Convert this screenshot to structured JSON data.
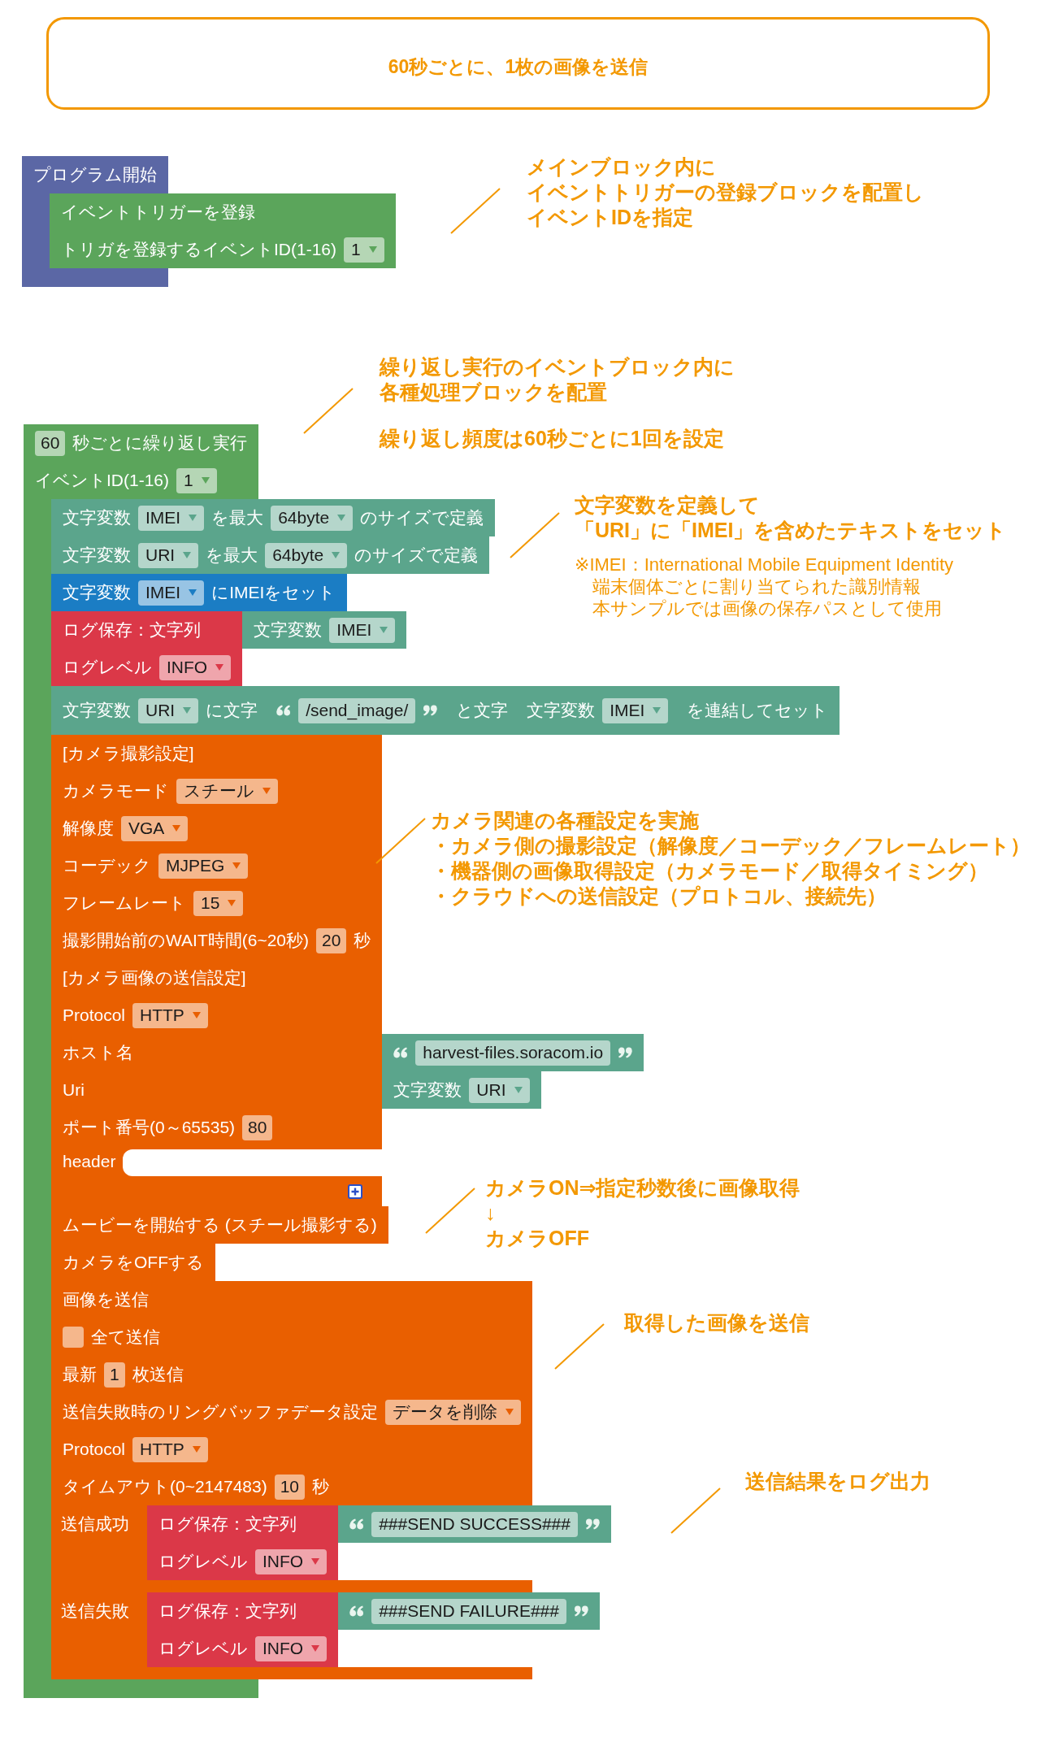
{
  "title_box": {
    "text": "60秒ごとに、1枚の画像を送信"
  },
  "blocks": [
    {
      "color": "#5b67a5",
      "rows": [
        {
          "kind": "fields",
          "fields": [
            {
              "kind": "label",
              "text": "プログラム開始"
            }
          ]
        },
        {
          "kind": "statements",
          "blocks": [
            {
              "color": "#5ba55b",
              "rows": [
                {
                  "kind": "fields",
                  "fields": [
                    {
                      "kind": "label",
                      "text": "イベントトリガーを登録"
                    }
                  ]
                },
                {
                  "kind": "fields",
                  "fields": [
                    {
                      "kind": "label",
                      "text": "トリガを登録するイベントID(1-16)"
                    },
                    {
                      "kind": "dropdown",
                      "value": "1"
                    }
                  ]
                }
              ]
            }
          ]
        }
      ]
    },
    {
      "color": "#5ba55b",
      "rows": [
        {
          "kind": "fields",
          "fields": [
            {
              "kind": "number",
              "value": "60"
            },
            {
              "kind": "label",
              "text": "秒ごとに繰り返し実行"
            }
          ]
        },
        {
          "kind": "fields",
          "fields": [
            {
              "kind": "label",
              "text": "イベントID(1-16)"
            },
            {
              "kind": "dropdown",
              "value": "1"
            }
          ]
        },
        {
          "kind": "statements",
          "blocks": [
            {
              "color": "#5ba58c",
              "rows": [
                {
                  "kind": "fields",
                  "fields": [
                    {
                      "kind": "label",
                      "text": "文字変数"
                    },
                    {
                      "kind": "dropdown",
                      "value": "IMEI"
                    },
                    {
                      "kind": "label",
                      "text": "を最大"
                    },
                    {
                      "kind": "dropdown",
                      "value": "64byte"
                    },
                    {
                      "kind": "label",
                      "text": "のサイズで定義"
                    }
                  ]
                }
              ]
            },
            {
              "color": "#5ba58c",
              "rows": [
                {
                  "kind": "fields",
                  "fields": [
                    {
                      "kind": "label",
                      "text": "文字変数"
                    },
                    {
                      "kind": "dropdown",
                      "value": "URI"
                    },
                    {
                      "kind": "label",
                      "text": "を最大"
                    },
                    {
                      "kind": "dropdown",
                      "value": "64byte"
                    },
                    {
                      "kind": "label",
                      "text": "のサイズで定義"
                    }
                  ]
                }
              ]
            },
            {
              "color": "#1b7dc4",
              "rows": [
                {
                  "kind": "fields",
                  "fields": [
                    {
                      "kind": "label",
                      "text": "文字変数"
                    },
                    {
                      "kind": "dropdown",
                      "value": "IMEI"
                    },
                    {
                      "kind": "label",
                      "text": "にIMEIをセット"
                    }
                  ]
                }
              ]
            },
            {
              "color": "#db3848",
              "rows": [
                {
                  "kind": "fields",
                  "fields": [
                    {
                      "kind": "label",
                      "text": "ログ保存：文字列"
                    }
                  ],
                  "input": {
                    "color": "#5ba58c",
                    "rows": [
                      {
                        "kind": "fields",
                        "fields": [
                          {
                            "kind": "label",
                            "text": "文字変数"
                          },
                          {
                            "kind": "dropdown",
                            "value": "IMEI"
                          }
                        ]
                      }
                    ]
                  }
                },
                {
                  "kind": "fields",
                  "fields": [
                    {
                      "kind": "label",
                      "text": "ログレベル"
                    },
                    {
                      "kind": "dropdown",
                      "value": "INFO"
                    }
                  ]
                }
              ]
            },
            {
              "color": "#5ba58c",
              "rows": [
                {
                  "kind": "fields",
                  "fields": [
                    {
                      "kind": "label",
                      "text": "文字変数"
                    },
                    {
                      "kind": "dropdown",
                      "value": "URI"
                    },
                    {
                      "kind": "label",
                      "text": "に文字"
                    },
                    {
                      "kind": "block",
                      "block": {
                        "color": "#5ba58c",
                        "rows": [
                          {
                            "kind": "fields",
                            "fields": [
                              {
                                "kind": "open_quote"
                              },
                              {
                                "kind": "text",
                                "value": "/send_image/"
                              },
                              {
                                "kind": "close_quote"
                              }
                            ]
                          }
                        ]
                      }
                    },
                    {
                      "kind": "label",
                      "text": "と文字"
                    },
                    {
                      "kind": "block",
                      "block": {
                        "color": "#5ba58c",
                        "rows": [
                          {
                            "kind": "fields",
                            "fields": [
                              {
                                "kind": "label",
                                "text": "文字変数"
                              },
                              {
                                "kind": "dropdown",
                                "value": "IMEI"
                              }
                            ]
                          }
                        ]
                      }
                    },
                    {
                      "kind": "label",
                      "text": "を連結してセット"
                    }
                  ]
                }
              ]
            },
            {
              "color": "#e95f00",
              "rows": [
                {
                  "kind": "fields",
                  "fields": [
                    {
                      "kind": "label",
                      "text": "[カメラ撮影設定]"
                    }
                  ]
                },
                {
                  "kind": "fields",
                  "fields": [
                    {
                      "kind": "label",
                      "text": "カメラモード"
                    },
                    {
                      "kind": "dropdown",
                      "value": "スチール"
                    }
                  ]
                },
                {
                  "kind": "fields",
                  "fields": [
                    {
                      "kind": "label",
                      "text": "解像度"
                    },
                    {
                      "kind": "dropdown",
                      "value": "VGA"
                    }
                  ]
                },
                {
                  "kind": "fields",
                  "fields": [
                    {
                      "kind": "label",
                      "text": "コーデック"
                    },
                    {
                      "kind": "dropdown",
                      "value": "MJPEG"
                    }
                  ]
                },
                {
                  "kind": "fields",
                  "fields": [
                    {
                      "kind": "label",
                      "text": "フレームレート"
                    },
                    {
                      "kind": "dropdown",
                      "value": "15"
                    }
                  ]
                },
                {
                  "kind": "fields",
                  "fields": [
                    {
                      "kind": "label",
                      "text": "撮影開始前のWAIT時間(6~20秒)"
                    },
                    {
                      "kind": "number",
                      "value": "20"
                    },
                    {
                      "kind": "label",
                      "text": "秒"
                    }
                  ]
                },
                {
                  "kind": "fields",
                  "fields": [
                    {
                      "kind": "label",
                      "text": "[カメラ画像の送信設定]"
                    }
                  ]
                },
                {
                  "kind": "fields",
                  "fields": [
                    {
                      "kind": "label",
                      "text": "Protocol"
                    },
                    {
                      "kind": "dropdown",
                      "value": "HTTP"
                    }
                  ]
                },
                {
                  "kind": "fields",
                  "fields": [
                    {
                      "kind": "label",
                      "text": "ホスト名"
                    }
                  ],
                  "input": {
                    "color": "#5ba58c",
                    "rows": [
                      {
                        "kind": "fields",
                        "fields": [
                          {
                            "kind": "open_quote"
                          },
                          {
                            "kind": "text",
                            "value": "harvest-files.soracom.io"
                          },
                          {
                            "kind": "close_quote"
                          }
                        ]
                      }
                    ]
                  }
                },
                {
                  "kind": "fields",
                  "fields": [
                    {
                      "kind": "label",
                      "text": "Uri"
                    }
                  ],
                  "input": {
                    "color": "#5ba58c",
                    "rows": [
                      {
                        "kind": "fields",
                        "fields": [
                          {
                            "kind": "label",
                            "text": "文字変数"
                          },
                          {
                            "kind": "dropdown",
                            "value": "URI"
                          }
                        ]
                      }
                    ]
                  }
                },
                {
                  "kind": "fields",
                  "fields": [
                    {
                      "kind": "label",
                      "text": "ポート番号(0～65535)"
                    },
                    {
                      "kind": "number",
                      "value": "80"
                    }
                  ]
                },
                {
                  "kind": "fields",
                  "fields": [
                    {
                      "kind": "label",
                      "text": "header"
                    },
                    {
                      "kind": "empty_input"
                    }
                  ]
                },
                {
                  "kind": "fields",
                  "fields": [
                    {
                      "kind": "add_button"
                    }
                  ]
                }
              ]
            },
            {
              "color": "#e95f00",
              "rows": [
                {
                  "kind": "fields",
                  "fields": [
                    {
                      "kind": "label",
                      "text": "ムービーを開始する (スチール撮影する)"
                    }
                  ]
                }
              ]
            },
            {
              "color": "#e95f00",
              "rows": [
                {
                  "kind": "fields",
                  "fields": [
                    {
                      "kind": "label",
                      "text": "カメラをOFFする"
                    }
                  ]
                }
              ]
            },
            {
              "color": "#e95f00",
              "rows": [
                {
                  "kind": "fields",
                  "fields": [
                    {
                      "kind": "label",
                      "text": "画像を送信"
                    }
                  ]
                },
                {
                  "kind": "fields",
                  "fields": [
                    {
                      "kind": "checkbox",
                      "checked": false
                    },
                    {
                      "kind": "label",
                      "text": "全て送信"
                    }
                  ]
                },
                {
                  "kind": "fields",
                  "fields": [
                    {
                      "kind": "label",
                      "text": "最新"
                    },
                    {
                      "kind": "number",
                      "value": "1"
                    },
                    {
                      "kind": "label",
                      "text": "枚送信"
                    }
                  ]
                },
                {
                  "kind": "fields",
                  "fields": [
                    {
                      "kind": "label",
                      "text": "送信失敗時のリングバッファデータ設定"
                    },
                    {
                      "kind": "dropdown",
                      "value": "データを削除"
                    }
                  ]
                },
                {
                  "kind": "fields",
                  "fields": [
                    {
                      "kind": "label",
                      "text": "Protocol"
                    },
                    {
                      "kind": "dropdown",
                      "value": "HTTP"
                    }
                  ]
                },
                {
                  "kind": "fields",
                  "fields": [
                    {
                      "kind": "label",
                      "text": "タイムアウト(0~2147483)"
                    },
                    {
                      "kind": "number",
                      "value": "10"
                    },
                    {
                      "kind": "label",
                      "text": "秒"
                    }
                  ]
                },
                {
                  "kind": "statements",
                  "label": "送信成功",
                  "blocks": [
                    {
                      "color": "#db3848",
                      "rows": [
                        {
                          "kind": "fields",
                          "fields": [
                            {
                              "kind": "label",
                              "text": "ログ保存：文字列"
                            }
                          ],
                          "input": {
                            "color": "#5ba58c",
                            "rows": [
                              {
                                "kind": "fields",
                                "fields": [
                                  {
                                    "kind": "open_quote"
                                  },
                                  {
                                    "kind": "text",
                                    "value": "###SEND SUCCESS###"
                                  },
                                  {
                                    "kind": "close_quote"
                                  }
                                ]
                              }
                            ]
                          }
                        },
                        {
                          "kind": "fields",
                          "fields": [
                            {
                              "kind": "label",
                              "text": "ログレベル"
                            },
                            {
                              "kind": "dropdown",
                              "value": "INFO"
                            }
                          ]
                        }
                      ]
                    }
                  ]
                },
                {
                  "kind": "statements",
                  "label": "送信失敗",
                  "blocks": [
                    {
                      "color": "#db3848",
                      "rows": [
                        {
                          "kind": "fields",
                          "fields": [
                            {
                              "kind": "label",
                              "text": "ログ保存：文字列"
                            }
                          ],
                          "input": {
                            "color": "#5ba58c",
                            "rows": [
                              {
                                "kind": "fields",
                                "fields": [
                                  {
                                    "kind": "open_quote"
                                  },
                                  {
                                    "kind": "text",
                                    "value": "###SEND FAILURE###"
                                  },
                                  {
                                    "kind": "close_quote"
                                  }
                                ]
                              }
                            ]
                          }
                        },
                        {
                          "kind": "fields",
                          "fields": [
                            {
                              "kind": "label",
                              "text": "ログレベル"
                            },
                            {
                              "kind": "dropdown",
                              "value": "INFO"
                            }
                          ]
                        }
                      ]
                    }
                  ]
                }
              ]
            }
          ]
        }
      ]
    }
  ],
  "annotations": [
    {
      "paragraphs": [
        {
          "kind": "main",
          "lines": [
            "メインブロック内に",
            "イベントトリガーの登録ブロックを配置し",
            "イベントIDを指定"
          ]
        }
      ]
    },
    {
      "paragraphs": [
        {
          "kind": "main",
          "lines": [
            "繰り返し実行のイベントブロック内に",
            "各種処理ブロックを配置"
          ]
        },
        {
          "kind": "main",
          "lines": [
            "繰り返し頻度は60秒ごとに1回を設定"
          ]
        }
      ]
    },
    {
      "paragraphs": [
        {
          "kind": "main",
          "lines": [
            "文字変数を定義して",
            "「URI」に「IMEI」を含めたテキストをセット"
          ]
        },
        {
          "kind": "note",
          "lines": [
            "※IMEI：International Mobile Equipment Identity",
            "端末個体ごとに割り当てられた識別情報",
            "本サンプルでは画像の保存パスとして使用"
          ]
        }
      ]
    },
    {
      "paragraphs": [
        {
          "kind": "main",
          "lines": [
            "カメラ関連の各種設定を実施",
            "・カメラ側の撮影設定（解像度／コーデック／フレームレート）",
            "・機器側の画像取得設定（カメラモード／取得タイミング）",
            "・クラウドへの送信設定（プロトコル、接続先）"
          ]
        }
      ]
    },
    {
      "paragraphs": [
        {
          "kind": "main",
          "lines": [
            "カメラON⇒指定秒数後に画像取得",
            "↓",
            "カメラOFF"
          ]
        }
      ]
    },
    {
      "paragraphs": [
        {
          "kind": "main",
          "lines": [
            "取得した画像を送信"
          ]
        }
      ]
    },
    {
      "paragraphs": [
        {
          "kind": "main",
          "lines": [
            "送信結果をログ出力"
          ]
        }
      ]
    }
  ]
}
